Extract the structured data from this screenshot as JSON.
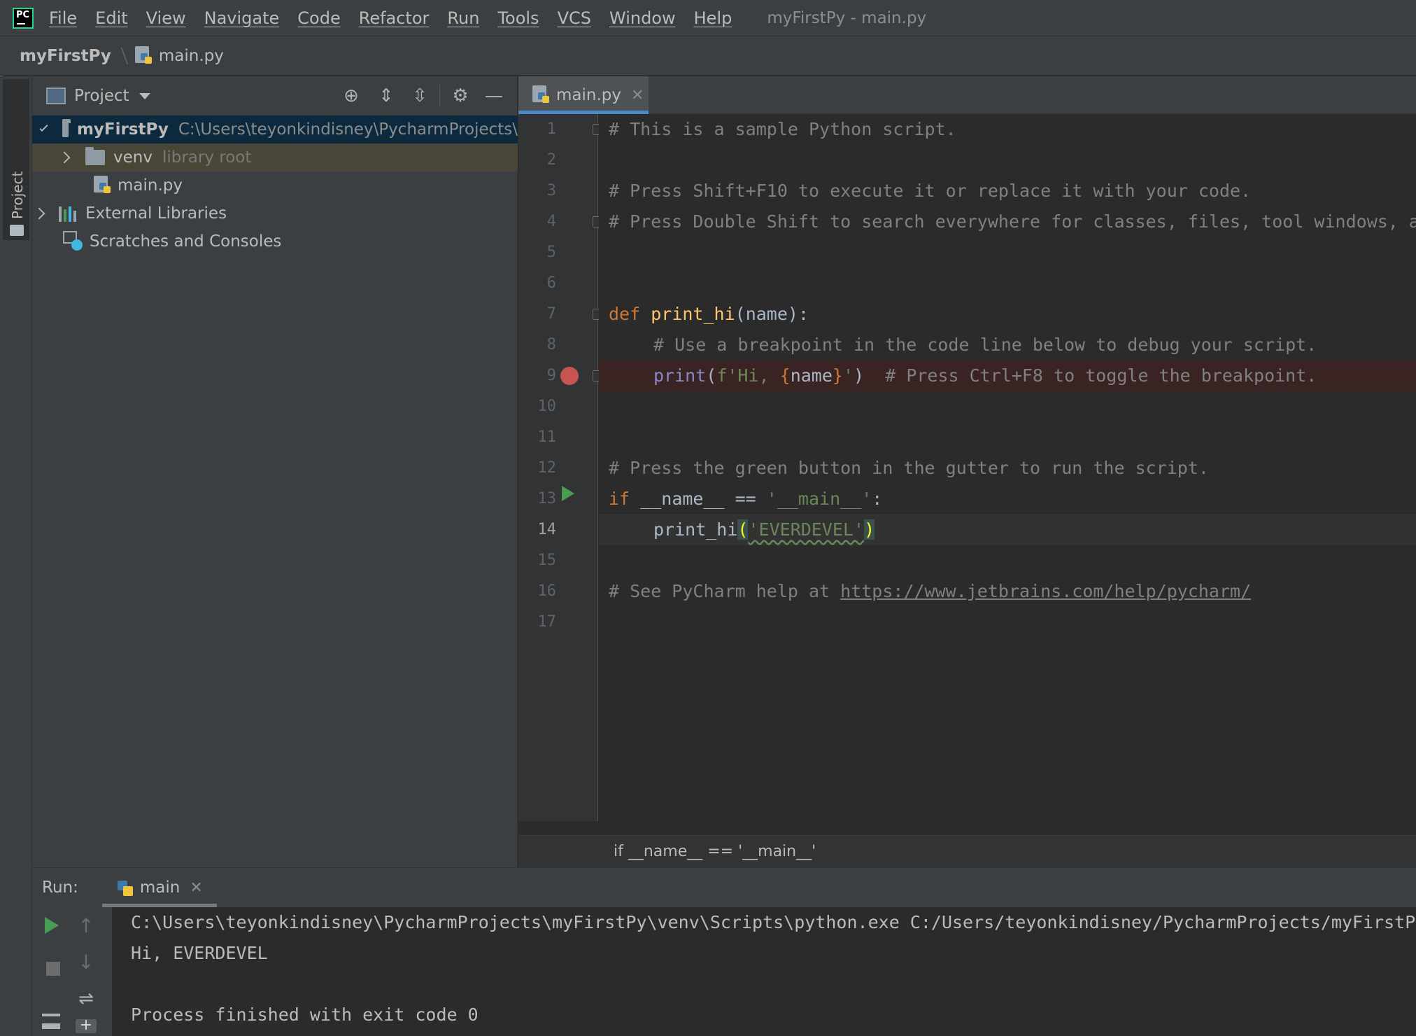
{
  "app": {
    "logo_text": "PC",
    "window_title": "myFirstPy - main.py"
  },
  "menu": [
    "File",
    "Edit",
    "View",
    "Navigate",
    "Code",
    "Refactor",
    "Run",
    "Tools",
    "VCS",
    "Window",
    "Help"
  ],
  "breadcrumb": {
    "project": "myFirstPy",
    "file": "main.py"
  },
  "tool_strip": {
    "project_tab": "Project"
  },
  "project_panel": {
    "title": "Project",
    "tree": [
      {
        "name": "myFirstPy",
        "hint": "C:\\Users\\teyonkindisney\\PycharmProjects\\"
      },
      {
        "name": "venv",
        "hint": "library root"
      },
      {
        "name": "main.py"
      },
      {
        "name": "External Libraries"
      },
      {
        "name": "Scratches and Consoles"
      }
    ]
  },
  "editor": {
    "tab": "main.py",
    "line_numbers": [
      "1",
      "2",
      "3",
      "4",
      "5",
      "6",
      "7",
      "8",
      "9",
      "10",
      "11",
      "12",
      "13",
      "14",
      "15",
      "16",
      "17"
    ],
    "current_line": 14,
    "breakpoint_line": 9,
    "run_gutter_line": 13,
    "code": {
      "l1": "# This is a sample Python script.",
      "l3": "# Press Shift+F10 to execute it or replace it with your code.",
      "l4": "# Press Double Shift to search everywhere for classes, files, tool windows, actions, and settings.",
      "l7_kw": "def",
      "l7_fn": "print_hi",
      "l7_rest": "(name):",
      "l8": "# Use a breakpoint in the code line below to debug your script.",
      "l9_builtin": "print",
      "l9_open": "(",
      "l9_str1": "f'Hi, ",
      "l9_brace_open": "{",
      "l9_var": "name",
      "l9_brace_close": "}",
      "l9_str2": "'",
      "l9_close": ")",
      "l9_comment": "# Press Ctrl+F8 to toggle the breakpoint.",
      "l12": "# Press the green button in the gutter to run the script.",
      "l13_kw": "if",
      "l13_mid": " __name__ == ",
      "l13_str": "'__main__'",
      "l13_end": ":",
      "l14_fn": "print_hi",
      "l14_open": "(",
      "l14_str": "'EVERDEVEL'",
      "l14_close": ")",
      "l16_text": "# See PyCharm help at ",
      "l16_link": "https://www.jetbrains.com/help/pycharm/"
    },
    "scope_breadcrumb": "if __name__ == '__main__'"
  },
  "run_panel": {
    "label": "Run:",
    "tab": "main",
    "console": [
      "C:\\Users\\teyonkindisney\\PycharmProjects\\myFirstPy\\venv\\Scripts\\python.exe C:/Users/teyonkindisney/PycharmProjects/myFirstPy/main.py",
      "Hi, EVERDEVEL",
      "",
      "Process finished with exit code 0"
    ]
  },
  "colors": {
    "accent": "#4a88c7",
    "breakpoint": "#c75450",
    "run": "#499c54"
  }
}
